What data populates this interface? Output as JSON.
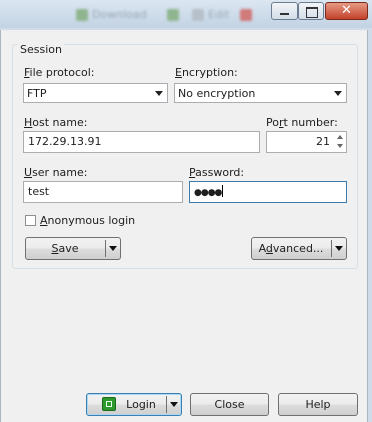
{
  "background_window": {
    "toolbar_labels": [
      "Download",
      "Edit"
    ]
  },
  "session": {
    "group_title": "Session",
    "file_protocol": {
      "label_first": "F",
      "label_rest": "ile protocol:",
      "value": "FTP"
    },
    "encryption": {
      "label_first": "E",
      "label_rest": "ncryption:",
      "value": "No encryption"
    },
    "host_name": {
      "label_first": "H",
      "label_rest": "ost name:",
      "value": "172.29.13.91"
    },
    "port_number": {
      "label_pre": "Po",
      "label_u": "r",
      "label_rest": "t number:",
      "value": "21"
    },
    "user_name": {
      "label_first": "U",
      "label_rest": "ser name:",
      "value": "test"
    },
    "password": {
      "label_first": "P",
      "label_rest": "assword:",
      "value": "●●●●"
    },
    "anonymous_login": {
      "label_first": "A",
      "label_rest": "nonymous login",
      "checked": false
    },
    "save_button": {
      "label_first": "S",
      "label_rest": "ave"
    },
    "advanced_button": {
      "label_pre": "A",
      "label_u": "d",
      "label_rest": "vanced..."
    }
  },
  "footer": {
    "login_label": "Login",
    "close_label": "Close",
    "help_label": "Help"
  },
  "colors": {
    "login_icon": "#2e9a2e",
    "close_button": "#c3422a"
  }
}
